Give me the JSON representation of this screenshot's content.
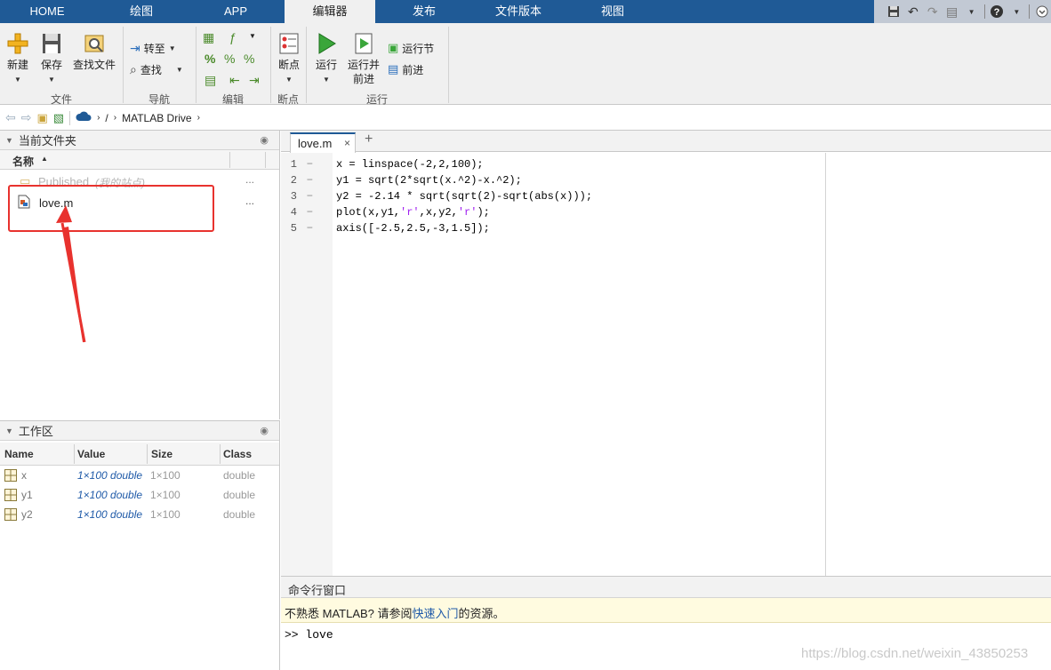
{
  "tabs": [
    "HOME",
    "绘图",
    "APP",
    "编辑器",
    "发布",
    "文件版本",
    "视图"
  ],
  "ribbon": {
    "file": {
      "new": "新建",
      "save": "保存",
      "find_files": "查找文件",
      "group": "文件"
    },
    "nav": {
      "goto": "转至",
      "find": "查找",
      "group": "导航"
    },
    "edit": {
      "group": "编辑"
    },
    "breakpoints": {
      "btn": "断点",
      "group": "断点"
    },
    "run": {
      "run": "运行",
      "run_advance_1": "运行并",
      "run_advance_2": "前进",
      "run_section": "运行节",
      "advance": "前进",
      "group": "运行"
    }
  },
  "address": {
    "separator": "/",
    "location": "MATLAB Drive"
  },
  "current_folder": {
    "title": "当前文件夹",
    "col_name": "名称",
    "items": [
      {
        "name": "Published",
        "note": "(我的站点)",
        "more": "..."
      },
      {
        "name": "love.m",
        "more": "..."
      }
    ]
  },
  "workspace": {
    "title": "工作区",
    "columns": [
      "Name",
      "Value",
      "Size",
      "Class"
    ],
    "rows": [
      {
        "name": "x",
        "value": "1×100 double",
        "size": "1×100",
        "class": "double"
      },
      {
        "name": "y1",
        "value": "1×100 double",
        "size": "1×100",
        "class": "double"
      },
      {
        "name": "y2",
        "value": "1×100 double",
        "size": "1×100",
        "class": "double"
      }
    ]
  },
  "editor": {
    "tab": "love.m",
    "close": "×",
    "add": "+",
    "lines": [
      {
        "n": "1",
        "dash": "−",
        "code": "x = linspace(-2,2,100);"
      },
      {
        "n": "2",
        "dash": "−",
        "code": "y1 = sqrt(2*sqrt(x.^2)-x.^2);"
      },
      {
        "n": "3",
        "dash": "−",
        "code": "y2 = -2.14 * sqrt(sqrt(2)-sqrt(abs(x)));"
      },
      {
        "n": "4",
        "dash": "−",
        "code_a": "plot(x,y1,",
        "str1": "'r'",
        "code_b": ",x,y2,",
        "str2": "'r'",
        "code_c": ");"
      },
      {
        "n": "5",
        "dash": "−",
        "code": "axis([-2.5,2.5,-3,1.5]);"
      }
    ]
  },
  "command": {
    "title": "命令行窗口",
    "notice_a": "不熟悉 MATLAB? 请参阅",
    "notice_link": "快速入门",
    "notice_b": "的资源。",
    "prompt": ">>",
    "input": "love"
  },
  "watermark": "https://blog.csdn.net/weixin_43850253",
  "colors": {
    "accent": "#1f5a96",
    "highlight": "#e8322e",
    "notice_bg": "#fffbe0"
  }
}
